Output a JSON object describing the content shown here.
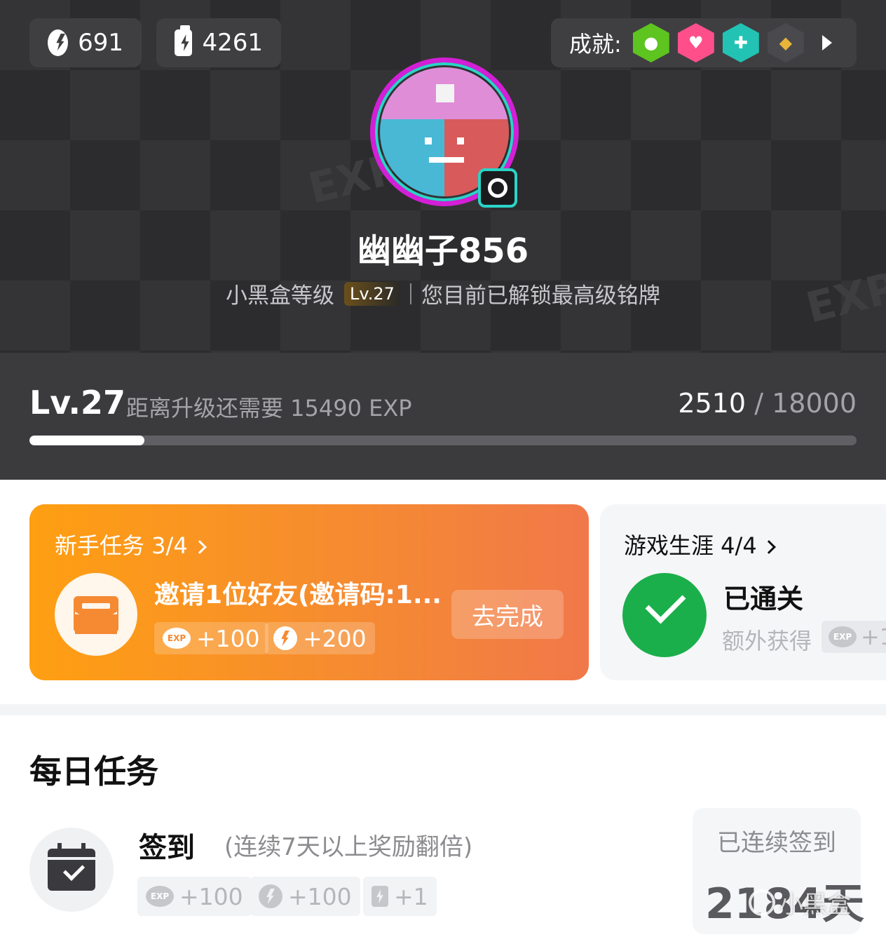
{
  "header": {
    "coins": "691",
    "energy": "4261",
    "achievements_label": "成就:",
    "achievement_badges": [
      {
        "icon": "person-icon",
        "color": "#5ec41f"
      },
      {
        "icon": "heart-icon",
        "color": "#ff4f8b"
      },
      {
        "icon": "gamepad-icon",
        "color": "#22c3b4"
      },
      {
        "icon": "diamond-icon",
        "color": "#4a4a4e"
      }
    ],
    "username": "幽幽子856",
    "level_label": "小黑盒等级",
    "level_badge": "Lv.27",
    "level_note": "您目前已解锁最高级铭牌"
  },
  "exp": {
    "level": "Lv.27",
    "need_text": "距离升级还需要 15490 EXP",
    "current": "2510",
    "separator": "/",
    "max": "18000",
    "progress_fraction": 0.1394
  },
  "newbie_task": {
    "title": "新手任务 3/4",
    "task_name": "邀请1位好友(邀请码:1...",
    "reward_exp": "+100",
    "reward_coin": "+200",
    "action_label": "去完成"
  },
  "career_task": {
    "title": "游戏生涯 4/4",
    "status": "已通关",
    "extra_label": "额外获得",
    "extra_reward": "+1"
  },
  "daily": {
    "title": "每日任务",
    "signin_title": "签到",
    "signin_note": "(连续7天以上奖励翻倍)",
    "reward_exp": "+100",
    "reward_coin": "+100",
    "reward_energy": "+1",
    "streak_label": "已连续签到",
    "streak_value": "2184天",
    "exp_chip_text": "EXP"
  },
  "watermark": "小黑盒"
}
